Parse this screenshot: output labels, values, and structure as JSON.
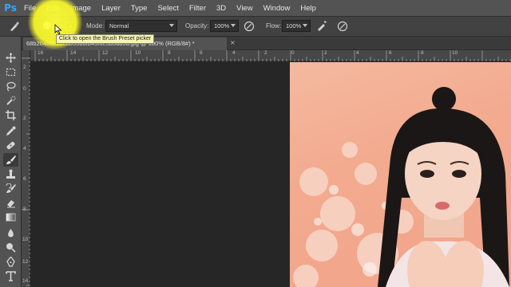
{
  "app": {
    "logo": "Ps"
  },
  "menu": [
    "File",
    "Edit",
    "Image",
    "Layer",
    "Type",
    "Select",
    "Filter",
    "3D",
    "View",
    "Window",
    "Help"
  ],
  "options": {
    "brush_size": "50",
    "mode_label": "Mode:",
    "mode_value": "Normal",
    "opacity_label": "Opacity:",
    "opacity_value": "100%",
    "flow_label": "Flow:",
    "flow_value": "100%"
  },
  "tooltip": "Click to open the Brush Preset picker",
  "document": {
    "tab_title": "68b204b6c1de8b35b6fb43f6e3b5ad9a.jpg @ 100% (RGB/8#) *",
    "close": "×"
  },
  "rulers": {
    "horizontal": [
      "16",
      "14",
      "12",
      "10",
      "8",
      "6",
      "4",
      "2",
      "0",
      "2",
      "4",
      "6",
      "8",
      "10"
    ],
    "vertical": [
      "2",
      "0",
      "2",
      "4",
      "6",
      "8",
      "10",
      "12",
      "14"
    ]
  },
  "colors": {
    "accent": "#31a8ff",
    "highlight": "#ffff3c",
    "tooltip_bg": "#f6f4b2",
    "photo_bg": "#f3ab8f"
  },
  "tools": [
    "move-icon",
    "marquee-icon",
    "lasso-icon",
    "quick-select-icon",
    "crop-icon",
    "eyedropper-icon",
    "healing-icon",
    "brush-icon",
    "clone-stamp-icon",
    "history-brush-icon",
    "eraser-icon",
    "gradient-icon",
    "blur-icon",
    "dodge-icon",
    "pen-icon",
    "type-icon"
  ]
}
